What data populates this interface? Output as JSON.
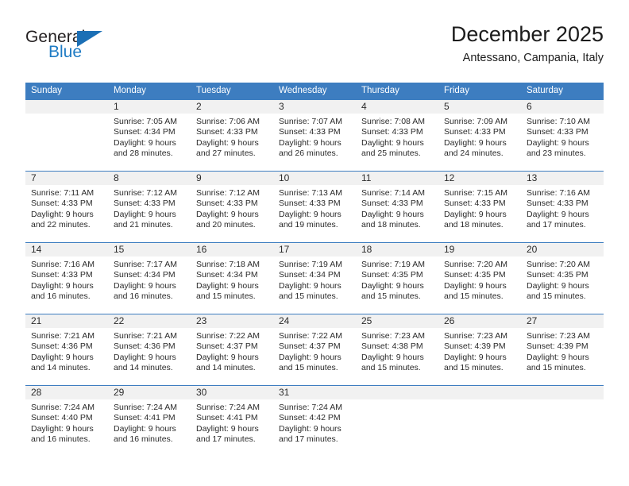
{
  "brand": {
    "name_part1": "General",
    "name_part2": "Blue",
    "triangle_color": "#1b6fb5",
    "blue_color": "#1e7bc4"
  },
  "header": {
    "title": "December 2025",
    "location": "Antessano, Campania, Italy",
    "header_bg": "#3d7dc0",
    "band_bg": "#f1f1f1"
  },
  "weekdays": [
    "Sunday",
    "Monday",
    "Tuesday",
    "Wednesday",
    "Thursday",
    "Friday",
    "Saturday"
  ],
  "weeks": [
    [
      {
        "day": "",
        "sunrise": "",
        "sunset": "",
        "daylight_line1": "",
        "daylight_line2": "",
        "empty": true
      },
      {
        "day": "1",
        "sunrise": "Sunrise: 7:05 AM",
        "sunset": "Sunset: 4:34 PM",
        "daylight_line1": "Daylight: 9 hours",
        "daylight_line2": "and 28 minutes."
      },
      {
        "day": "2",
        "sunrise": "Sunrise: 7:06 AM",
        "sunset": "Sunset: 4:33 PM",
        "daylight_line1": "Daylight: 9 hours",
        "daylight_line2": "and 27 minutes."
      },
      {
        "day": "3",
        "sunrise": "Sunrise: 7:07 AM",
        "sunset": "Sunset: 4:33 PM",
        "daylight_line1": "Daylight: 9 hours",
        "daylight_line2": "and 26 minutes."
      },
      {
        "day": "4",
        "sunrise": "Sunrise: 7:08 AM",
        "sunset": "Sunset: 4:33 PM",
        "daylight_line1": "Daylight: 9 hours",
        "daylight_line2": "and 25 minutes."
      },
      {
        "day": "5",
        "sunrise": "Sunrise: 7:09 AM",
        "sunset": "Sunset: 4:33 PM",
        "daylight_line1": "Daylight: 9 hours",
        "daylight_line2": "and 24 minutes."
      },
      {
        "day": "6",
        "sunrise": "Sunrise: 7:10 AM",
        "sunset": "Sunset: 4:33 PM",
        "daylight_line1": "Daylight: 9 hours",
        "daylight_line2": "and 23 minutes."
      }
    ],
    [
      {
        "day": "7",
        "sunrise": "Sunrise: 7:11 AM",
        "sunset": "Sunset: 4:33 PM",
        "daylight_line1": "Daylight: 9 hours",
        "daylight_line2": "and 22 minutes."
      },
      {
        "day": "8",
        "sunrise": "Sunrise: 7:12 AM",
        "sunset": "Sunset: 4:33 PM",
        "daylight_line1": "Daylight: 9 hours",
        "daylight_line2": "and 21 minutes."
      },
      {
        "day": "9",
        "sunrise": "Sunrise: 7:12 AM",
        "sunset": "Sunset: 4:33 PM",
        "daylight_line1": "Daylight: 9 hours",
        "daylight_line2": "and 20 minutes."
      },
      {
        "day": "10",
        "sunrise": "Sunrise: 7:13 AM",
        "sunset": "Sunset: 4:33 PM",
        "daylight_line1": "Daylight: 9 hours",
        "daylight_line2": "and 19 minutes."
      },
      {
        "day": "11",
        "sunrise": "Sunrise: 7:14 AM",
        "sunset": "Sunset: 4:33 PM",
        "daylight_line1": "Daylight: 9 hours",
        "daylight_line2": "and 18 minutes."
      },
      {
        "day": "12",
        "sunrise": "Sunrise: 7:15 AM",
        "sunset": "Sunset: 4:33 PM",
        "daylight_line1": "Daylight: 9 hours",
        "daylight_line2": "and 18 minutes."
      },
      {
        "day": "13",
        "sunrise": "Sunrise: 7:16 AM",
        "sunset": "Sunset: 4:33 PM",
        "daylight_line1": "Daylight: 9 hours",
        "daylight_line2": "and 17 minutes."
      }
    ],
    [
      {
        "day": "14",
        "sunrise": "Sunrise: 7:16 AM",
        "sunset": "Sunset: 4:33 PM",
        "daylight_line1": "Daylight: 9 hours",
        "daylight_line2": "and 16 minutes."
      },
      {
        "day": "15",
        "sunrise": "Sunrise: 7:17 AM",
        "sunset": "Sunset: 4:34 PM",
        "daylight_line1": "Daylight: 9 hours",
        "daylight_line2": "and 16 minutes."
      },
      {
        "day": "16",
        "sunrise": "Sunrise: 7:18 AM",
        "sunset": "Sunset: 4:34 PM",
        "daylight_line1": "Daylight: 9 hours",
        "daylight_line2": "and 15 minutes."
      },
      {
        "day": "17",
        "sunrise": "Sunrise: 7:19 AM",
        "sunset": "Sunset: 4:34 PM",
        "daylight_line1": "Daylight: 9 hours",
        "daylight_line2": "and 15 minutes."
      },
      {
        "day": "18",
        "sunrise": "Sunrise: 7:19 AM",
        "sunset": "Sunset: 4:35 PM",
        "daylight_line1": "Daylight: 9 hours",
        "daylight_line2": "and 15 minutes."
      },
      {
        "day": "19",
        "sunrise": "Sunrise: 7:20 AM",
        "sunset": "Sunset: 4:35 PM",
        "daylight_line1": "Daylight: 9 hours",
        "daylight_line2": "and 15 minutes."
      },
      {
        "day": "20",
        "sunrise": "Sunrise: 7:20 AM",
        "sunset": "Sunset: 4:35 PM",
        "daylight_line1": "Daylight: 9 hours",
        "daylight_line2": "and 15 minutes."
      }
    ],
    [
      {
        "day": "21",
        "sunrise": "Sunrise: 7:21 AM",
        "sunset": "Sunset: 4:36 PM",
        "daylight_line1": "Daylight: 9 hours",
        "daylight_line2": "and 14 minutes."
      },
      {
        "day": "22",
        "sunrise": "Sunrise: 7:21 AM",
        "sunset": "Sunset: 4:36 PM",
        "daylight_line1": "Daylight: 9 hours",
        "daylight_line2": "and 14 minutes."
      },
      {
        "day": "23",
        "sunrise": "Sunrise: 7:22 AM",
        "sunset": "Sunset: 4:37 PM",
        "daylight_line1": "Daylight: 9 hours",
        "daylight_line2": "and 14 minutes."
      },
      {
        "day": "24",
        "sunrise": "Sunrise: 7:22 AM",
        "sunset": "Sunset: 4:37 PM",
        "daylight_line1": "Daylight: 9 hours",
        "daylight_line2": "and 15 minutes."
      },
      {
        "day": "25",
        "sunrise": "Sunrise: 7:23 AM",
        "sunset": "Sunset: 4:38 PM",
        "daylight_line1": "Daylight: 9 hours",
        "daylight_line2": "and 15 minutes."
      },
      {
        "day": "26",
        "sunrise": "Sunrise: 7:23 AM",
        "sunset": "Sunset: 4:39 PM",
        "daylight_line1": "Daylight: 9 hours",
        "daylight_line2": "and 15 minutes."
      },
      {
        "day": "27",
        "sunrise": "Sunrise: 7:23 AM",
        "sunset": "Sunset: 4:39 PM",
        "daylight_line1": "Daylight: 9 hours",
        "daylight_line2": "and 15 minutes."
      }
    ],
    [
      {
        "day": "28",
        "sunrise": "Sunrise: 7:24 AM",
        "sunset": "Sunset: 4:40 PM",
        "daylight_line1": "Daylight: 9 hours",
        "daylight_line2": "and 16 minutes."
      },
      {
        "day": "29",
        "sunrise": "Sunrise: 7:24 AM",
        "sunset": "Sunset: 4:41 PM",
        "daylight_line1": "Daylight: 9 hours",
        "daylight_line2": "and 16 minutes."
      },
      {
        "day": "30",
        "sunrise": "Sunrise: 7:24 AM",
        "sunset": "Sunset: 4:41 PM",
        "daylight_line1": "Daylight: 9 hours",
        "daylight_line2": "and 17 minutes."
      },
      {
        "day": "31",
        "sunrise": "Sunrise: 7:24 AM",
        "sunset": "Sunset: 4:42 PM",
        "daylight_line1": "Daylight: 9 hours",
        "daylight_line2": "and 17 minutes."
      },
      {
        "day": "",
        "sunrise": "",
        "sunset": "",
        "daylight_line1": "",
        "daylight_line2": "",
        "empty": true
      },
      {
        "day": "",
        "sunrise": "",
        "sunset": "",
        "daylight_line1": "",
        "daylight_line2": "",
        "empty": true
      },
      {
        "day": "",
        "sunrise": "",
        "sunset": "",
        "daylight_line1": "",
        "daylight_line2": "",
        "empty": true
      }
    ]
  ]
}
